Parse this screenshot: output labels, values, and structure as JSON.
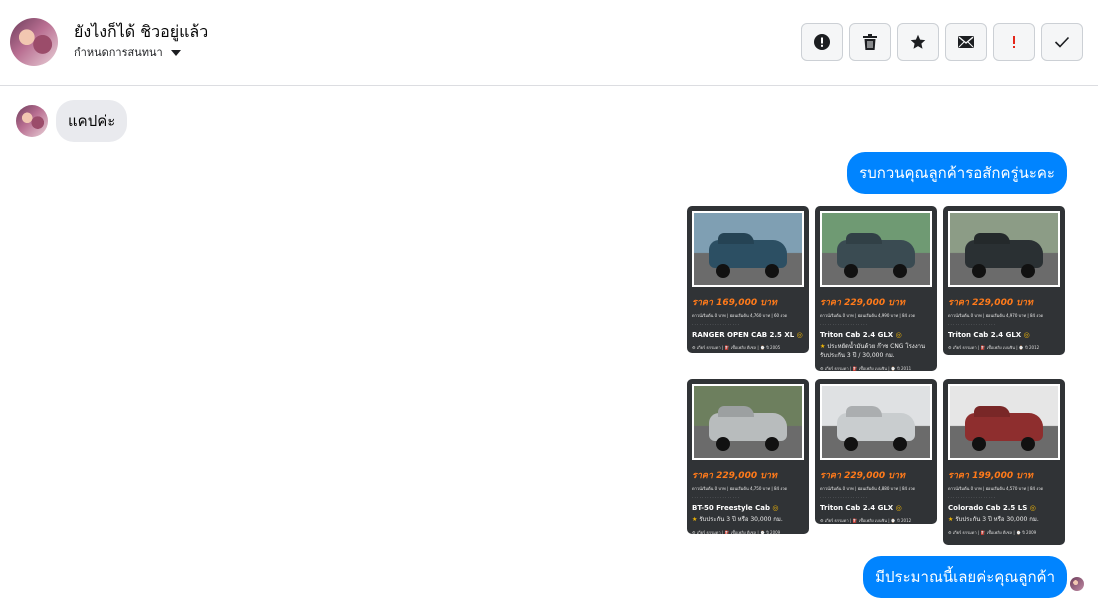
{
  "header": {
    "title": "ยังไงก็ได้ ชิวอยู่แล้ว",
    "subtitle": "กำหนดการสนทนา",
    "actions": [
      {
        "name": "report-button",
        "icon": "alert-circle-icon"
      },
      {
        "name": "delete-button",
        "icon": "trash-icon"
      },
      {
        "name": "star-button",
        "icon": "star-icon"
      },
      {
        "name": "mail-button",
        "icon": "envelope-icon"
      },
      {
        "name": "important-button",
        "icon": "exclamation-icon",
        "color": "#e4271b"
      },
      {
        "name": "done-button",
        "icon": "check-icon"
      }
    ]
  },
  "messages": {
    "incoming_1": "แคปค่ะ",
    "outgoing_1": "รบกวนคุณลูกค้ารอสักครู่นะคะ",
    "outgoing_2": "มีประมาณนี้เลยค่ะคุณลูกค้า"
  },
  "cards": [
    {
      "price": "ราคา 169,000 บาท",
      "specs": "ดาวน์เริ่มต้น 0 บาท | ผ่อนเริ่มต้น 4,760 บาท | 60 งวด",
      "model": "RANGER OPEN CAB 2.5 XL",
      "promo": "",
      "foot": "⚙ เกียร์ ธรรมดา   |   ⛽ เชื้อเพลิง ดีเซล   |   ⌚ ปี 2005",
      "car_color": "#2c4f63",
      "bg_color": "#7f9fb3"
    },
    {
      "price": "ราคา 229,000 บาท",
      "specs": "ดาวน์เริ่มต้น 0 บาท | ผ่อนเริ่มต้น 4,990 บาท | 84 งวด",
      "model": "Triton Cab 2.4 GLX",
      "promo": "ประหยัดน้ำมันด้วย ก๊าซ CNG โรงงาน รับประกัน 3 ปี / 30,000 กม.",
      "foot": "⚙ เกียร์ ธรรมดา   |   ⛽ เชื้อเพลิง เบนซิน   |   ⌚ ปี 2011",
      "car_color": "#3a4b52",
      "bg_color": "#6f9a73"
    },
    {
      "price": "ราคา 229,000 บาท",
      "specs": "ดาวน์เริ่มต้น 0 บาท | ผ่อนเริ่มต้น 4,970 บาท | 84 งวด",
      "model": "Triton Cab 2.4 GLX",
      "promo": "",
      "foot": "⚙ เกียร์ ธรรมดา   |   ⛽ เชื้อเพลิง เบนซิน   |   ⌚ ปี 2012",
      "car_color": "#2a3033",
      "bg_color": "#8c9c86"
    },
    {
      "price": "ราคา 229,000 บาท",
      "specs": "ดาวน์เริ่มต้น 0 บาท | ผ่อนเริ่มต้น 4,750 บาท | 84 งวด",
      "model": "BT-50 Freestyle Cab",
      "promo": "รับประกัน 3 ปี หรือ 30,000 กม.",
      "foot": "⚙ เกียร์ ธรรมดา   |   ⛽ เชื้อเพลิง ดีเซล   |   ⌚ ปี 2009",
      "car_color": "#b8bcbd",
      "bg_color": "#6d7f5e"
    },
    {
      "price": "ราคา 229,000 บาท",
      "specs": "ดาวน์เริ่มต้น 0 บาท | ผ่อนเริ่มต้น 4,880 บาท | 84 งวด",
      "model": "Triton Cab 2.4 GLX",
      "promo": "",
      "foot": "⚙ เกียร์ ธรรมดา   |   ⛽ เชื้อเพลิง เบนซิน   |   ⌚ ปี 2012",
      "car_color": "#c9cdcf",
      "bg_color": "#dfe1e3"
    },
    {
      "price": "ราคา 199,000 บาท",
      "specs": "ดาวน์เริ่มต้น 0 บาท | ผ่อนเริ่มต้น 4,570 บาท | 84 งวด",
      "model": "Colorado Cab 2.5 LS",
      "promo": "รับประกัน 3 ปี หรือ 30,000 กม.",
      "foot": "⚙ เกียร์ ธรรมดา   |   ⛽ เชื้อเพลิง ดีเซล   |   ⌚ ปี 2009",
      "car_color": "#8e2e2e",
      "bg_color": "#e6e6e6"
    }
  ]
}
